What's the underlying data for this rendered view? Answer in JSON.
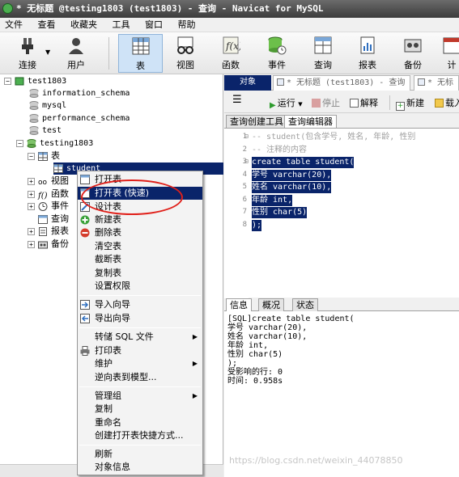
{
  "window": {
    "title": "* 无标题 @testing1803 (test1803) - 查询 - Navicat for MySQL"
  },
  "menu": [
    "文件",
    "查看",
    "收藏夹",
    "工具",
    "窗口",
    "帮助"
  ],
  "toolbar": {
    "connect": "连接",
    "user": "用户",
    "table": "表",
    "view": "视图",
    "function": "函数",
    "event": "事件",
    "query": "查询",
    "report": "报表",
    "backup": "备份",
    "schedule": "计"
  },
  "tree": {
    "conn1": "test1803",
    "db_info": "information_schema",
    "db_mysql": "mysql",
    "db_perf": "performance_schema",
    "db_test": "test",
    "conn2": "testing1803",
    "tables": "表",
    "student": "student",
    "views": "视图",
    "functions": "函数",
    "events": "事件",
    "queries": "查询",
    "reports": "报表",
    "backups": "备份"
  },
  "context_menu": {
    "open_table": "打开表",
    "open_table_fast": "打开表 (快速)",
    "design_table": "设计表",
    "new_table": "新建表",
    "delete_table": "删除表",
    "empty_table": "清空表",
    "truncate_table": "截断表",
    "copy_table": "复制表",
    "set_permissions": "设置权限",
    "import_wizard": "导入向导",
    "export_wizard": "导出向导",
    "dump_sql": "转储 SQL 文件",
    "print_table": "打印表",
    "maintain": "维护",
    "reverse_model": "逆向表到模型...",
    "manage_group": "管理组",
    "copy": "复制",
    "rename": "重命名",
    "create_shortcut": "创建打开表快捷方式...",
    "refresh": "刷新",
    "object_info": "对象信息"
  },
  "tabs": {
    "objects": "对象",
    "query_tab": "* 无标题 (test1803) - 查询",
    "query_tab2": "* 无标"
  },
  "query_toolbar": {
    "run": "运行",
    "stop": "停止",
    "explain": "解释",
    "new": "新建",
    "load": "载入"
  },
  "subtabs": {
    "builder": "查询创建工具",
    "editor": "查询编辑器"
  },
  "editor": {
    "lines": [
      {
        "n": "1",
        "text": "-- student(包含学号, 姓名, 年龄, 性别",
        "kind": "comment"
      },
      {
        "n": "2",
        "text": "-- 注释的内容",
        "kind": "comment"
      },
      {
        "n": "3",
        "text": "create table student(",
        "kind": "selected"
      },
      {
        "n": "4",
        "text": "学号 varchar(20),",
        "kind": "selected"
      },
      {
        "n": "5",
        "text": "姓名 varchar(10),",
        "kind": "selected"
      },
      {
        "n": "6",
        "text": "年龄 int,",
        "kind": "selected"
      },
      {
        "n": "7",
        "text": "性别 char(5)",
        "kind": "selected"
      },
      {
        "n": "8",
        "text": ");",
        "kind": "selected"
      }
    ]
  },
  "info_tabs": {
    "info": "信息",
    "profile": "概况",
    "status": "状态"
  },
  "info": {
    "lines": [
      "[SQL]create table student(",
      "学号 varchar(20),",
      "姓名 varchar(10),",
      "年龄 int,",
      "性别 char(5)",
      ");",
      "受影响的行: 0",
      "时间: 0.958s"
    ]
  },
  "watermark": "https://blog.csdn.net/weixin_44078850"
}
